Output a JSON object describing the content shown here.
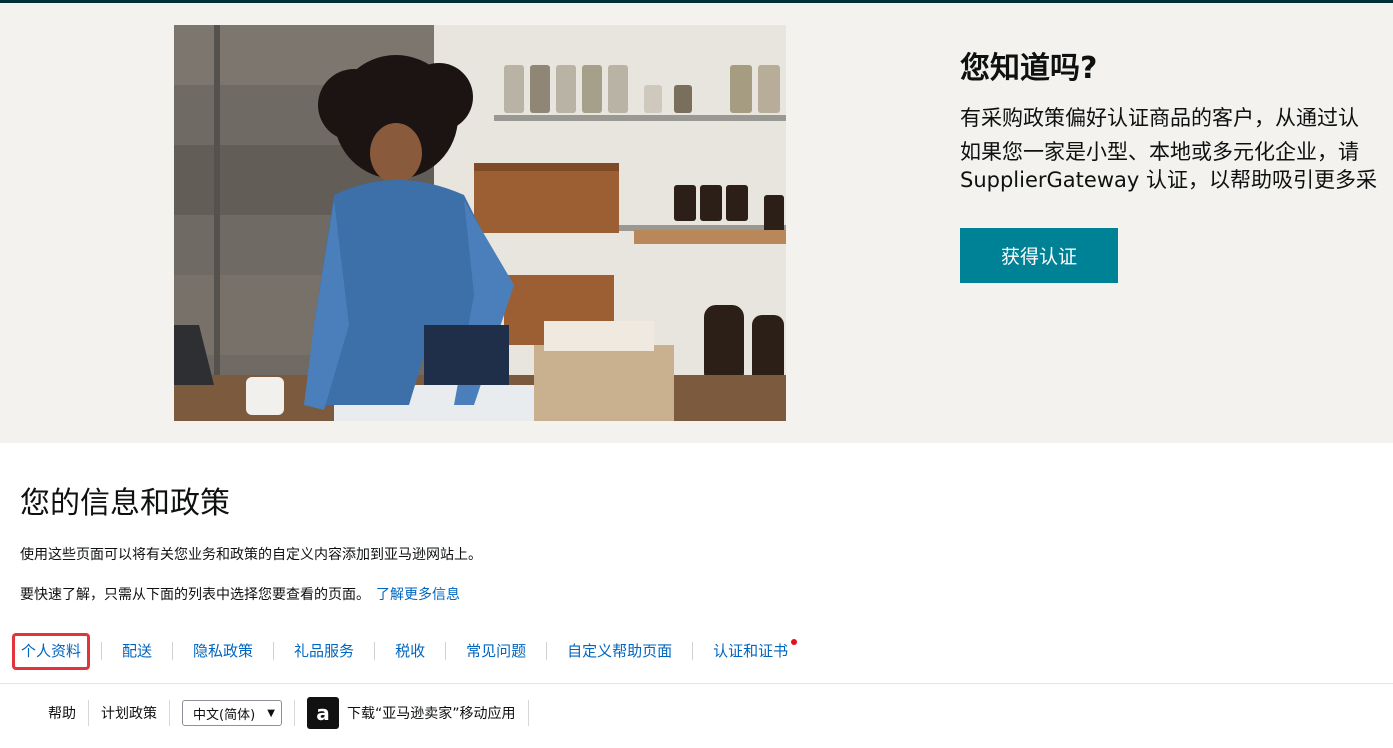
{
  "hero": {
    "title": "您知道吗?",
    "lines": [
      "有采购政策偏好认证商品的客户，从通过认",
      "如果您一家是小型、本地或多元化企业，请",
      "SupplierGateway 认证，以帮助吸引更多采"
    ],
    "cta_label": "获得认证",
    "photo_alt": "",
    "colors": {
      "cta": "#008296",
      "background": "#f3f2ef"
    }
  },
  "info": {
    "title": "您的信息和政策",
    "desc1": "使用这些页面可以将有关您业务和政策的自定义内容添加到亚马逊网站上。",
    "desc2": "要快速了解，只需从下面的列表中选择您要查看的页面。",
    "learn_more": "了解更多信息"
  },
  "tabs": [
    {
      "label": "个人资料",
      "active": true
    },
    {
      "label": "配送"
    },
    {
      "label": "隐私政策"
    },
    {
      "label": "礼品服务"
    },
    {
      "label": "税收"
    },
    {
      "label": "常见问题"
    },
    {
      "label": "自定义帮助页面"
    },
    {
      "label": "认证和证书",
      "notification": true
    }
  ],
  "footer": {
    "help": "帮助",
    "program_policy": "计划政策",
    "language": "中文(简体)",
    "app_icon": "a",
    "app_download": "下载“亚马逊卖家”移动应用"
  }
}
